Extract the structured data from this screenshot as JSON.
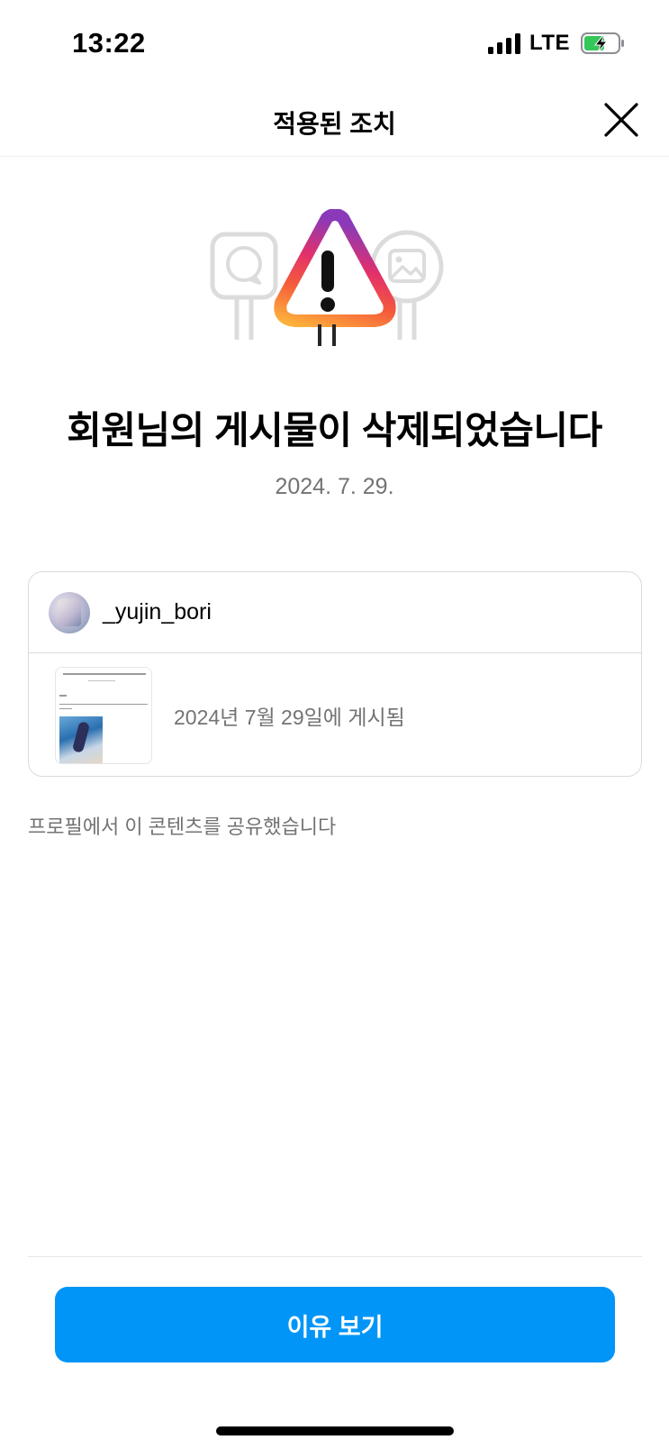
{
  "status_bar": {
    "time": "13:22",
    "network": "LTE",
    "battery_level": 0.6,
    "charging": true,
    "signal_bars": 4
  },
  "header": {
    "title": "적용된 조치",
    "close_icon": "close-icon"
  },
  "notice": {
    "illustration_icon": "warning-icon",
    "headline": "회원님의 게시물이 삭제되었습니다",
    "date": "2024. 7. 29."
  },
  "post_card": {
    "username": "_yujin_bori",
    "posted_text": "2024년 7월 29일에 게시됨"
  },
  "share_note": "프로필에서 이 콘텐츠를 공유했습니다",
  "cta": {
    "label": "이유 보기"
  },
  "colors": {
    "accent": "#0095f6",
    "secondary_text": "#737373",
    "border": "#dbdbdb"
  }
}
